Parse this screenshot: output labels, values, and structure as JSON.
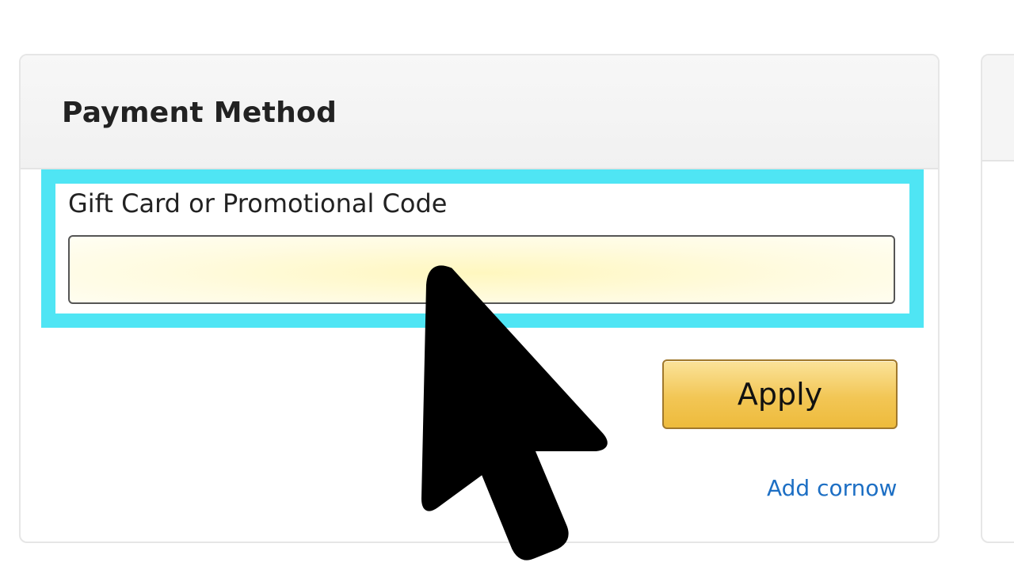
{
  "payment": {
    "title": "Payment Method",
    "gift_card": {
      "label": "Gift Card or Promotional Code",
      "value": "",
      "placeholder": ""
    },
    "apply_label": "Apply",
    "add_link_label": "Add cornow"
  },
  "colors": {
    "highlight": "#4fe5f4",
    "apply_button": "#f2c655",
    "link": "#1d6fc4",
    "input_fill": "#fff7bf"
  },
  "icons": {
    "cursor": "mouse-pointer-arrow-icon"
  }
}
